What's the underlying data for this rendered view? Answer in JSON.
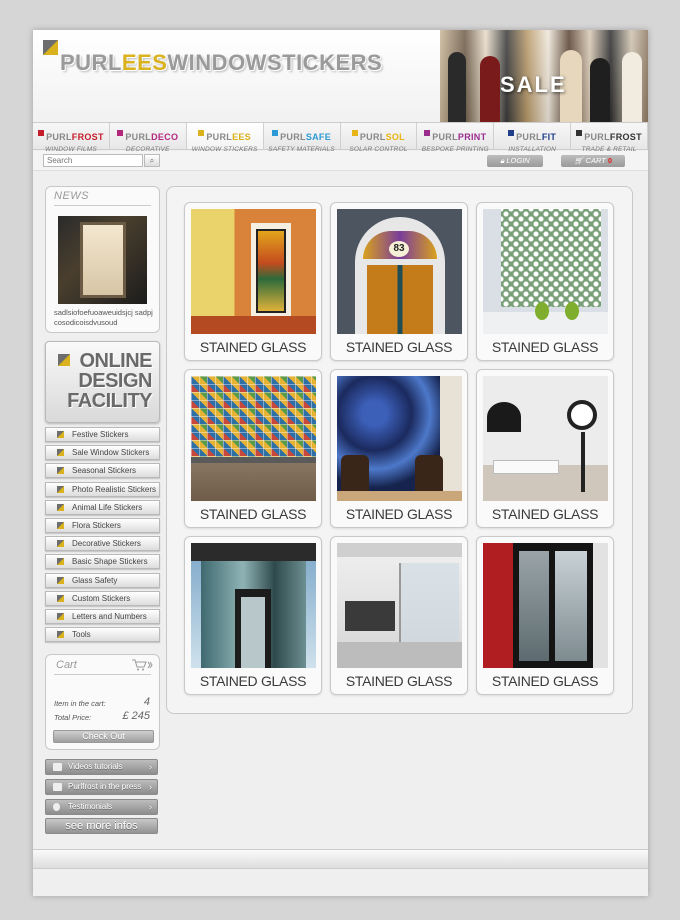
{
  "brand": {
    "logo_part1": "PURL",
    "logo_part2": "EES",
    "logo_part3": "WINDOWSTICKERS"
  },
  "banner": {
    "sale_text": "SALE"
  },
  "tabs": [
    {
      "prefix": "PURL",
      "accent": "FROST",
      "sub": "WINDOW FILMS",
      "color": "#c41d2a"
    },
    {
      "prefix": "PURL",
      "accent": "DECO",
      "sub": "DECORATIVE COVERINGS",
      "color": "#b3277e"
    },
    {
      "prefix": "PURL",
      "accent": "EES",
      "sub": "WINDOW STICKERS",
      "color": "#d9b21d"
    },
    {
      "prefix": "PURL",
      "accent": "SAFE",
      "sub": "SAFETY MATERIALS",
      "color": "#2b9ad4"
    },
    {
      "prefix": "PURL",
      "accent": "SOL",
      "sub": "SOLAR CONTROL",
      "color": "#e8b417"
    },
    {
      "prefix": "PURL",
      "accent": "PRINT",
      "sub": "BESPOKE PRINTING",
      "color": "#9a2d8e"
    },
    {
      "prefix": "PURL",
      "accent": "FIT",
      "sub": "INSTALLATION SERVICE",
      "color": "#203f8a"
    },
    {
      "prefix": "PURL",
      "accent": "FROST",
      "sub": "TRADE & RETAIL",
      "color": "#333333"
    }
  ],
  "search": {
    "placeholder": "Search",
    "button": "⌕"
  },
  "account": {
    "login": "LOGIN",
    "cart_label": "CART",
    "cart_count": "0"
  },
  "news": {
    "title": "NEWS",
    "text": "sadlsiofoefuoaweuidsjcj sadpjcosodicoisdvusoud"
  },
  "design": {
    "line1": "ONLINE",
    "line2": "DESIGN",
    "line3": "FACILITY"
  },
  "categories": [
    "Festive Stickers",
    "Sale Window Stickers",
    "Seasonal Stickers",
    "Photo Realistic Stickers",
    "Animal Life Stickers",
    "Flora Stickers",
    "Decorative Stickers",
    "Basic Shape Stickers",
    "Glass Safety",
    "Custom Stickers",
    "Letters and Numbers",
    "Tools"
  ],
  "cart": {
    "title": "Cart",
    "items_label": "Item in the cart:",
    "items_value": "4",
    "total_label": "Total Price:",
    "total_value": "£ 245",
    "checkout": "Check Out"
  },
  "side_links": [
    {
      "label": "Videos tutorials",
      "arrow": "›"
    },
    {
      "label": "Purlfrost in the press",
      "arrow": "›"
    },
    {
      "label": "Testimonials",
      "arrow": "›"
    }
  ],
  "more": "see more infos",
  "products": [
    {
      "label": "STAINED GLASS",
      "scene": "artdeco-window"
    },
    {
      "label": "STAINED GLASS",
      "scene": "door-83"
    },
    {
      "label": "STAINED GLASS",
      "scene": "lace-window"
    },
    {
      "label": "STAINED GLASS",
      "scene": "kitchen-tiles"
    },
    {
      "label": "STAINED GLASS",
      "scene": "blue-damask"
    },
    {
      "label": "STAINED GLASS",
      "scene": "clock-room"
    },
    {
      "label": "STAINED GLASS",
      "scene": "glass-building"
    },
    {
      "label": "STAINED GLASS",
      "scene": "office-glass"
    },
    {
      "label": "STAINED GLASS",
      "scene": "red-door"
    }
  ]
}
